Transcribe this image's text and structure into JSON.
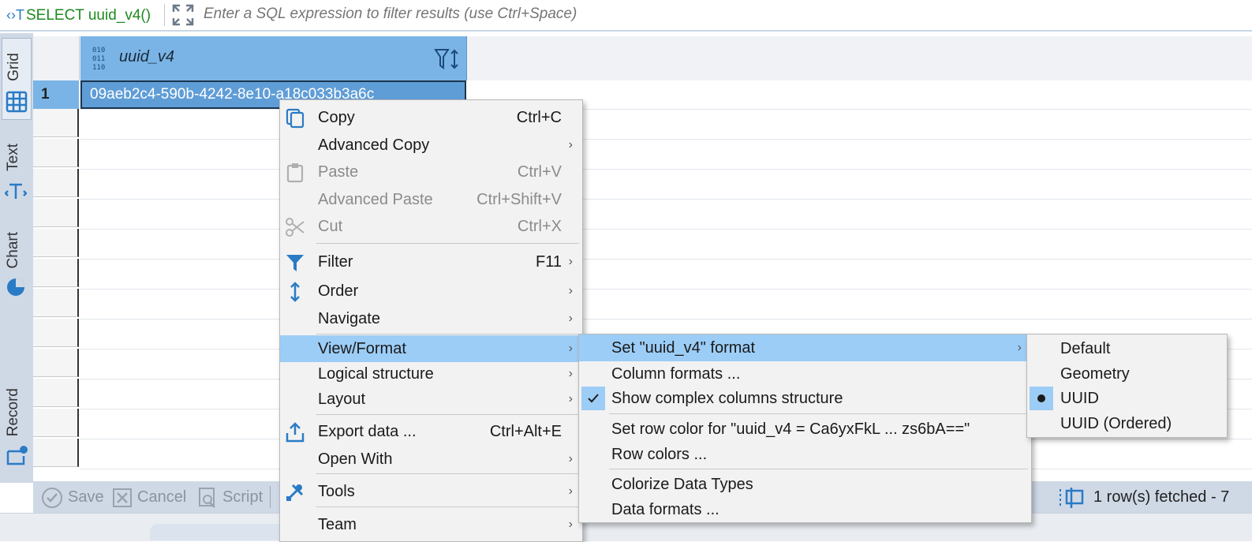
{
  "filter_bar": {
    "sql_text": "SELECT uuid_v4()",
    "placeholder": "Enter a SQL expression to filter results (use Ctrl+Space)"
  },
  "side_tabs": [
    {
      "label": "Grid",
      "icon": "grid-icon"
    },
    {
      "label": "Text",
      "icon": "text-icon"
    },
    {
      "label": "Chart",
      "icon": "pie-chart-icon"
    },
    {
      "label": "Record",
      "icon": "record-icon"
    }
  ],
  "grid": {
    "column_header": "uuid_v4",
    "rows": [
      {
        "num": "1",
        "value": "09aeb2c4-590b-4242-8e10-a18c033b3a6c"
      }
    ]
  },
  "bottom_bar": {
    "save_label": "Save",
    "cancel_label": "Cancel",
    "script_label": "Script",
    "status": "1 row(s) fetched - 7"
  },
  "context_menu": {
    "copy": {
      "label": "Copy",
      "shortcut": "Ctrl+C"
    },
    "advanced_copy": {
      "label": "Advanced Copy"
    },
    "paste": {
      "label": "Paste",
      "shortcut": "Ctrl+V"
    },
    "advanced_paste": {
      "label": "Advanced Paste",
      "shortcut": "Ctrl+Shift+V"
    },
    "cut": {
      "label": "Cut",
      "shortcut": "Ctrl+X"
    },
    "filter": {
      "label": "Filter",
      "shortcut": "F11"
    },
    "order": {
      "label": "Order"
    },
    "navigate": {
      "label": "Navigate"
    },
    "view_format": {
      "label": "View/Format"
    },
    "logical_structure": {
      "label": "Logical structure"
    },
    "layout": {
      "label": "Layout"
    },
    "export_data": {
      "label": "Export data ...",
      "shortcut": "Ctrl+Alt+E"
    },
    "open_with": {
      "label": "Open With"
    },
    "tools": {
      "label": "Tools"
    },
    "team": {
      "label": "Team"
    },
    "arrow": "›"
  },
  "view_format_menu": {
    "set_format": "Set \"uuid_v4\" format",
    "column_formats": "Column formats ...",
    "show_complex": "Show complex columns structure",
    "set_row_color": "Set row color for \"uuid_v4 = Ca6yxFkL ... zs6bA==\"",
    "row_colors": "Row colors ...",
    "colorize": "Colorize Data Types",
    "data_formats": "Data formats ..."
  },
  "format_menu": {
    "options": [
      "Default",
      "Geometry",
      "UUID",
      "UUID (Ordered)"
    ],
    "selected": "UUID"
  },
  "colors": {
    "highlight": "#9ccdf6",
    "header_blue": "#7ab4e6",
    "sql_green": "#1d8a1d",
    "icon_blue": "#2a7bc5"
  }
}
